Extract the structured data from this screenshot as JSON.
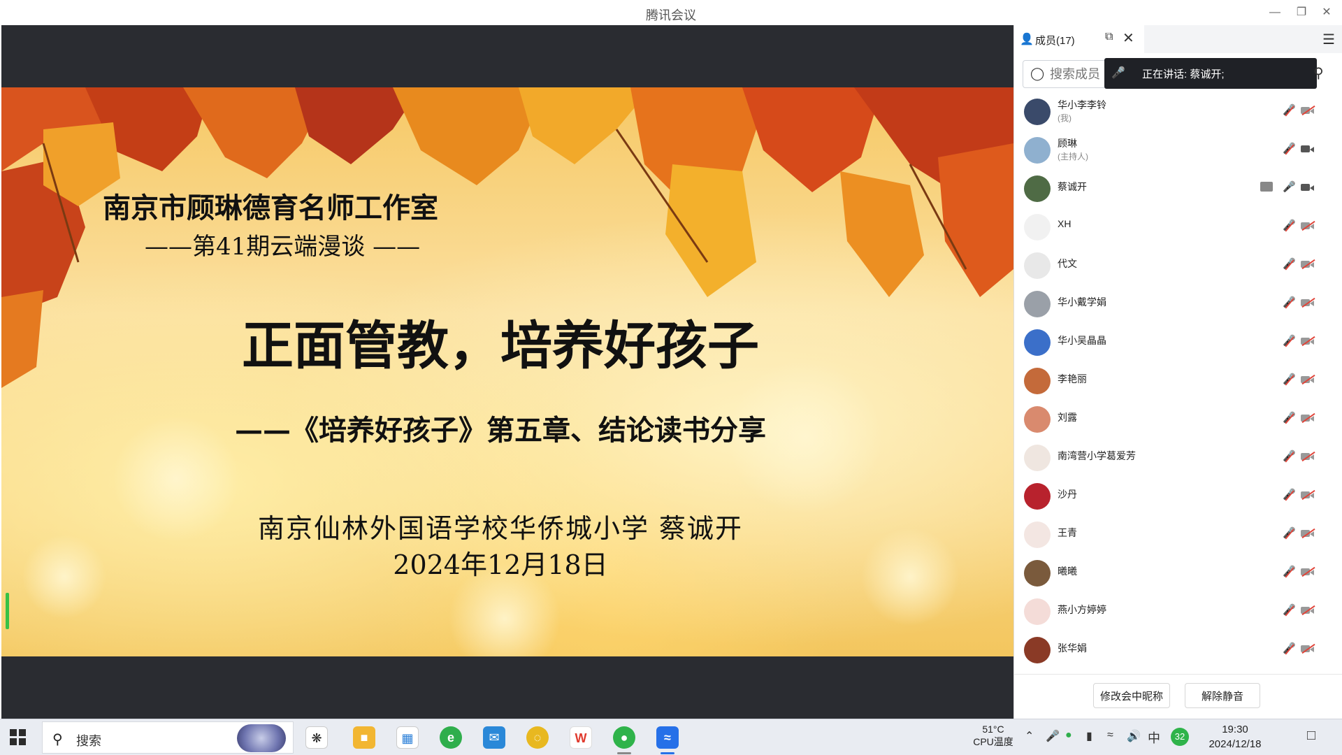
{
  "window": {
    "title": "腾讯会议"
  },
  "slide": {
    "studio": "南京市顾琳德育名师工作室",
    "episode": "——第41期云端漫谈 ——",
    "main_title": "正面管教，培养好孩子",
    "subtitle": "——《培养好孩子》第五章、结论读书分享",
    "author": "南京仙林外国语学校华侨城小学 蔡诚开",
    "date": "2024年12月18日"
  },
  "panel": {
    "tab_label": "成员(17)",
    "search_placeholder": "搜索成员",
    "speaking_label": "正在讲话:  蔡诚开;",
    "members": [
      {
        "name": "华小李李铃",
        "role": "(我)",
        "mic": "muted",
        "cam": "off",
        "avatar_color": "#3a4a6a"
      },
      {
        "name": "顾琳",
        "role": "(主持人)",
        "mic": "muted",
        "cam": "on",
        "avatar_color": "#8fb0cf"
      },
      {
        "name": "蔡诚开",
        "role": "",
        "mic": "active",
        "cam": "on",
        "sharing": true,
        "avatar_color": "#4f6b45"
      },
      {
        "name": "XH",
        "role": "",
        "mic": "muted",
        "cam": "off",
        "avatar_color": "#f1f1f1"
      },
      {
        "name": "代文",
        "role": "",
        "mic": "muted",
        "cam": "off",
        "avatar_color": "#e8e8e8"
      },
      {
        "name": "华小戴学娟",
        "role": "",
        "mic": "muted",
        "cam": "off",
        "avatar_color": "#9aa0a8"
      },
      {
        "name": "华小吴晶晶",
        "role": "",
        "mic": "muted",
        "cam": "off",
        "avatar_color": "#3b6fc9"
      },
      {
        "name": "李艳丽",
        "role": "",
        "mic": "muted",
        "cam": "off",
        "avatar_color": "#c46a3a"
      },
      {
        "name": "刘露",
        "role": "",
        "mic": "muted",
        "cam": "off",
        "avatar_color": "#d98a6e"
      },
      {
        "name": "南湾营小学葛爱芳",
        "role": "",
        "mic": "muted",
        "cam": "off",
        "avatar_color": "#efe6e0"
      },
      {
        "name": "沙丹",
        "role": "",
        "mic": "muted",
        "cam": "off",
        "avatar_color": "#b8222d"
      },
      {
        "name": "王青",
        "role": "",
        "mic": "muted",
        "cam": "off",
        "avatar_color": "#f3e6e2"
      },
      {
        "name": "曦曦",
        "role": "",
        "mic": "muted",
        "cam": "off",
        "avatar_color": "#7a5a3c"
      },
      {
        "name": "燕小方婷婷",
        "role": "",
        "mic": "muted",
        "cam": "off",
        "avatar_color": "#f4dcd8"
      },
      {
        "name": "张华娟",
        "role": "",
        "mic": "muted",
        "cam": "off",
        "avatar_color": "#8a3a26"
      }
    ],
    "rename_button": "修改会中昵称",
    "unmute_button": "解除静音"
  },
  "taskbar": {
    "search_label": "搜索",
    "temp_value": "51°C",
    "temp_label": "CPU温度",
    "ime": "中",
    "badge": "32",
    "time": "19:30",
    "date": "2024/12/18"
  },
  "colors": {
    "share_bg": "#2a2c31",
    "accent_green": "#37c146",
    "muted_red": "#e0453a"
  }
}
